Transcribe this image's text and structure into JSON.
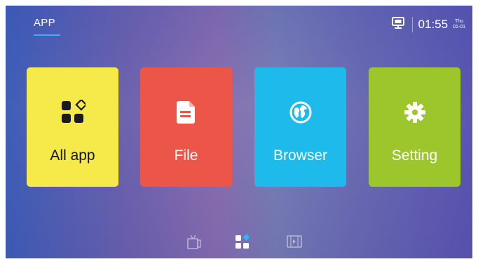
{
  "header": {
    "tab_label": "APP",
    "accent_color": "#2fb4f5"
  },
  "status": {
    "cast_icon": "screen-cast-icon",
    "time": "01:55",
    "day": "Thu",
    "date": "01-01"
  },
  "tiles": [
    {
      "label": "All app",
      "icon": "apps-grid-icon",
      "color": "#f6ea4a"
    },
    {
      "label": "File",
      "icon": "document-icon",
      "color": "#eb5648"
    },
    {
      "label": "Browser",
      "icon": "globe-icon",
      "color": "#1ebaec"
    },
    {
      "label": "Setting",
      "icon": "gear-icon",
      "color": "#9cc62c"
    }
  ],
  "dock": [
    {
      "icon": "tv-icon",
      "active": false
    },
    {
      "icon": "apps-grid-icon",
      "active": true
    },
    {
      "icon": "media-player-icon",
      "active": false
    }
  ]
}
